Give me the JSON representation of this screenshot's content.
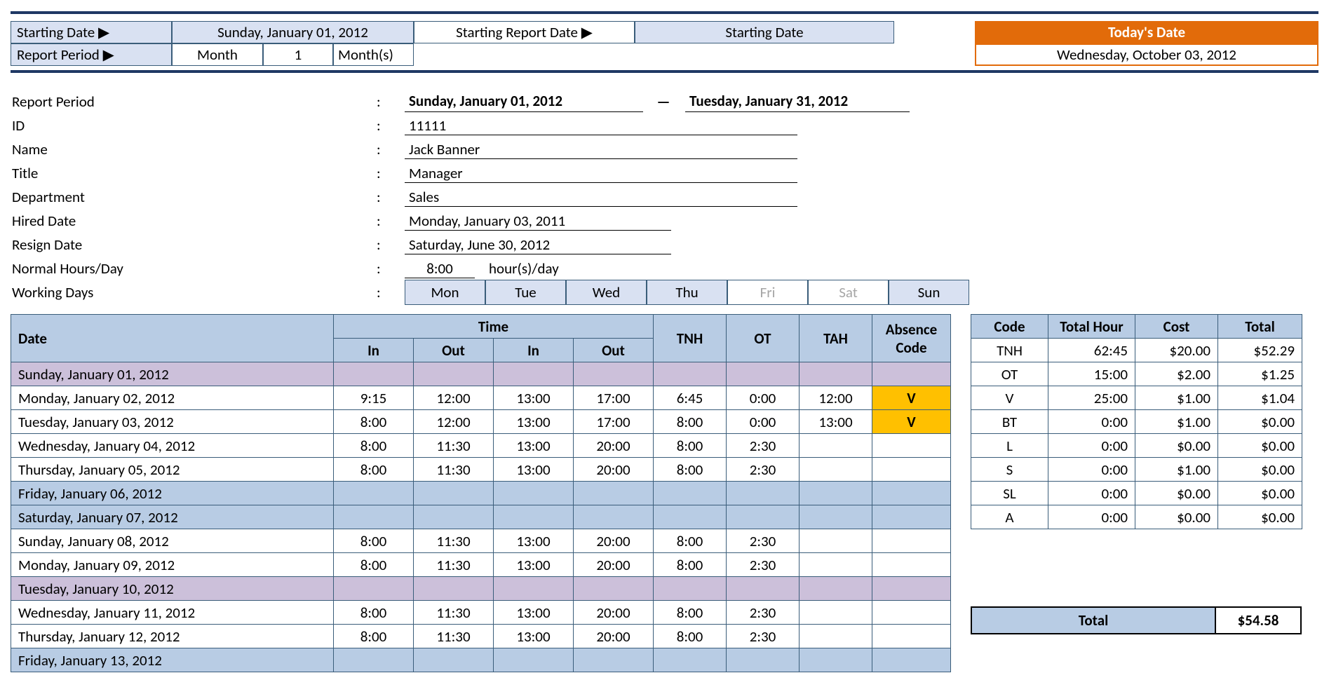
{
  "topbar": {
    "starting_date_label": "Starting Date ▶",
    "starting_date_value": "Sunday, January 01, 2012",
    "starting_report_label": "Starting Report Date ▶",
    "starting_report_value": "Starting Date",
    "report_period_label": "Report Period ▶",
    "rp_unit_type": "Month",
    "rp_number": "1",
    "rp_unit": "Month(s)",
    "today_label": "Today's Date",
    "today_value": "Wednesday, October 03, 2012"
  },
  "info": {
    "report_period_lbl": "Report Period",
    "report_period_from": "Sunday, January 01, 2012",
    "report_period_to": "Tuesday, January 31, 2012",
    "id_lbl": "ID",
    "id": "11111",
    "name_lbl": "Name",
    "name": "Jack Banner",
    "title_lbl": "Title",
    "title": "Manager",
    "dept_lbl": "Department",
    "dept": "Sales",
    "hired_lbl": "Hired Date",
    "hired": "Monday, January 03, 2011",
    "resign_lbl": "Resign Date",
    "resign": "Saturday, June 30, 2012",
    "nhd_lbl": "Normal Hours/Day",
    "nhd_val": "8:00",
    "nhd_unit": "hour(s)/day",
    "wd_lbl": "Working Days"
  },
  "working_days": [
    "Mon",
    "Tue",
    "Wed",
    "Thu",
    "Fri",
    "Sat",
    "Sun"
  ],
  "working_days_active": [
    true,
    true,
    true,
    true,
    false,
    false,
    true
  ],
  "table": {
    "headers": {
      "date": "Date",
      "time": "Time",
      "in": "In",
      "out": "Out",
      "tnh": "TNH",
      "ot": "OT",
      "tah": "TAH",
      "abs": "Absence Code"
    },
    "rows": [
      {
        "date": "Sunday, January 01, 2012",
        "style": "purple"
      },
      {
        "date": "Monday, January 02, 2012",
        "in1": "9:15",
        "out1": "12:00",
        "in2": "13:00",
        "out2": "17:00",
        "tnh": "6:45",
        "ot": "0:00",
        "tah": "12:00",
        "abs": "V"
      },
      {
        "date": "Tuesday, January 03, 2012",
        "in1": "8:00",
        "out1": "12:00",
        "in2": "13:00",
        "out2": "17:00",
        "tnh": "8:00",
        "ot": "0:00",
        "tah": "13:00",
        "abs": "V"
      },
      {
        "date": "Wednesday, January 04, 2012",
        "in1": "8:00",
        "out1": "11:30",
        "in2": "13:00",
        "out2": "20:00",
        "tnh": "8:00",
        "ot": "2:30"
      },
      {
        "date": "Thursday, January 05, 2012",
        "in1": "8:00",
        "out1": "11:30",
        "in2": "13:00",
        "out2": "20:00",
        "tnh": "8:00",
        "ot": "2:30"
      },
      {
        "date": "Friday, January 06, 2012",
        "style": "blue"
      },
      {
        "date": "Saturday, January 07, 2012",
        "style": "blue"
      },
      {
        "date": "Sunday, January 08, 2012",
        "in1": "8:00",
        "out1": "11:30",
        "in2": "13:00",
        "out2": "20:00",
        "tnh": "8:00",
        "ot": "2:30"
      },
      {
        "date": "Monday, January 09, 2012",
        "in1": "8:00",
        "out1": "11:30",
        "in2": "13:00",
        "out2": "20:00",
        "tnh": "8:00",
        "ot": "2:30"
      },
      {
        "date": "Tuesday, January 10, 2012",
        "style": "purple"
      },
      {
        "date": "Wednesday, January 11, 2012",
        "in1": "8:00",
        "out1": "11:30",
        "in2": "13:00",
        "out2": "20:00",
        "tnh": "8:00",
        "ot": "2:30"
      },
      {
        "date": "Thursday, January 12, 2012",
        "in1": "8:00",
        "out1": "11:30",
        "in2": "13:00",
        "out2": "20:00",
        "tnh": "8:00",
        "ot": "2:30"
      },
      {
        "date": "Friday, January 13, 2012",
        "style": "blue"
      }
    ]
  },
  "summary": {
    "headers": {
      "code": "Code",
      "hour": "Total Hour",
      "cost": "Cost",
      "total": "Total"
    },
    "rows": [
      {
        "code": "TNH",
        "hour": "62:45",
        "cost": "$20.00",
        "total": "$52.29"
      },
      {
        "code": "OT",
        "hour": "15:00",
        "cost": "$2.00",
        "total": "$1.25"
      },
      {
        "code": "V",
        "hour": "25:00",
        "cost": "$1.00",
        "total": "$1.04"
      },
      {
        "code": "BT",
        "hour": "0:00",
        "cost": "$1.00",
        "total": "$0.00"
      },
      {
        "code": "L",
        "hour": "0:00",
        "cost": "$0.00",
        "total": "$0.00"
      },
      {
        "code": "S",
        "hour": "0:00",
        "cost": "$1.00",
        "total": "$0.00"
      },
      {
        "code": "SL",
        "hour": "0:00",
        "cost": "$0.00",
        "total": "$0.00"
      },
      {
        "code": "A",
        "hour": "0:00",
        "cost": "$0.00",
        "total": "$0.00"
      }
    ],
    "grand_label": "Total",
    "grand_value": "$54.58"
  }
}
